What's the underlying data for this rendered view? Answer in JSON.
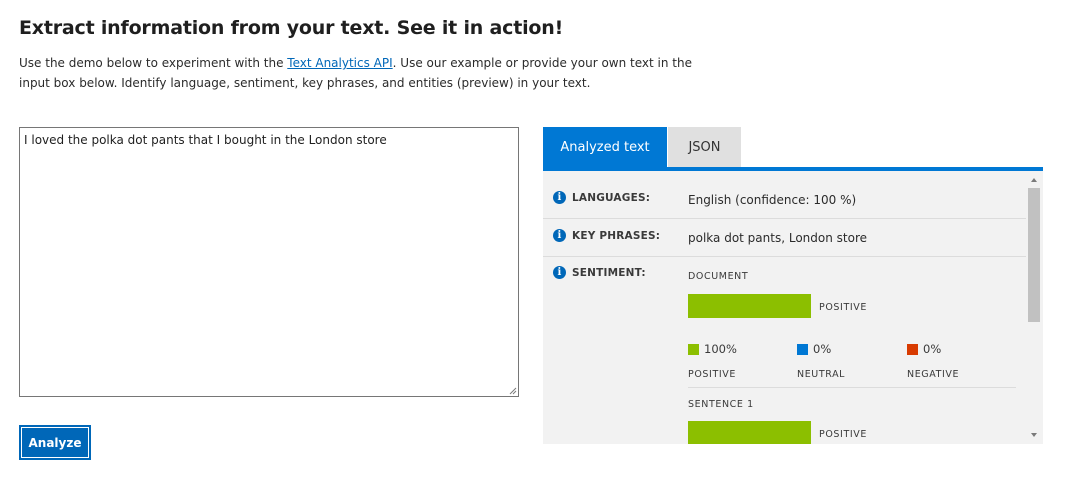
{
  "header": {
    "title": "Extract information from your text. See it in action!",
    "intro_before": "Use the demo below to experiment with the ",
    "intro_link": "Text Analytics API",
    "intro_after": ". Use our example or provide your own text in the input box below. Identify language, sentiment, key phrases, and entities (preview) in your text."
  },
  "input": {
    "value": "I loved the polka dot pants that I bought in the London store"
  },
  "analyze_button": {
    "label": "Analyze"
  },
  "tabs": [
    {
      "label": "Analyzed text",
      "active": true
    },
    {
      "label": "JSON",
      "active": false
    }
  ],
  "results": {
    "languages": {
      "label": "LANGUAGES:",
      "value": "English (confidence: 100 %)"
    },
    "key_phrases": {
      "label": "KEY PHRASES:",
      "value": "polka dot pants, London store"
    },
    "sentiment": {
      "label": "SENTIMENT:",
      "document_heading": "DOCUMENT",
      "document_positive_fraction": 1.0,
      "document_tag": "POSITIVE",
      "breakdown": [
        {
          "value": "100%",
          "caption": "POSITIVE",
          "color": "#8cbf00"
        },
        {
          "value": "0%",
          "caption": "NEUTRAL",
          "color": "#0078d4"
        },
        {
          "value": "0%",
          "caption": "NEGATIVE",
          "color": "#d83b01"
        }
      ],
      "sentence_heading": "SENTENCE 1",
      "sentence_positive_fraction": 1.0,
      "sentence_tag": "POSITIVE"
    }
  },
  "colors": {
    "accent": "#0078d4",
    "button": "#0067b8",
    "positive": "#8cbf00",
    "neutral": "#0078d4",
    "negative": "#d83b01"
  },
  "icons": {
    "info": "info-icon"
  }
}
